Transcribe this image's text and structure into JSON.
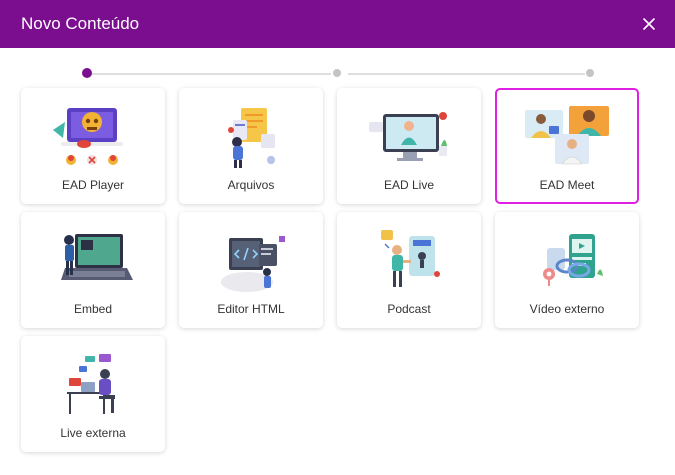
{
  "dialog": {
    "title": "Novo Conteúdo",
    "close_icon": "close-icon"
  },
  "stepper": {
    "steps": 3,
    "current_step": 1
  },
  "colors": {
    "header": "#7b0e8f",
    "selected_border": "#e020e0",
    "stepper_active": "#7b0e8f",
    "stepper_inactive": "#c4c4c4"
  },
  "options": [
    {
      "label": "EAD Player",
      "icon": "ead-player-illustration",
      "selected": false
    },
    {
      "label": "Arquivos",
      "icon": "arquivos-illustration",
      "selected": false
    },
    {
      "label": "EAD Live",
      "icon": "ead-live-illustration",
      "selected": false
    },
    {
      "label": "EAD Meet",
      "icon": "ead-meet-illustration",
      "selected": true
    },
    {
      "label": "Embed",
      "icon": "embed-illustration",
      "selected": false
    },
    {
      "label": "Editor HTML",
      "icon": "editor-html-illustration",
      "selected": false
    },
    {
      "label": "Podcast",
      "icon": "podcast-illustration",
      "selected": false
    },
    {
      "label": "Vídeo externo",
      "icon": "video-externo-illustration",
      "selected": false
    },
    {
      "label": "Live externa",
      "icon": "live-externa-illustration",
      "selected": false
    }
  ]
}
